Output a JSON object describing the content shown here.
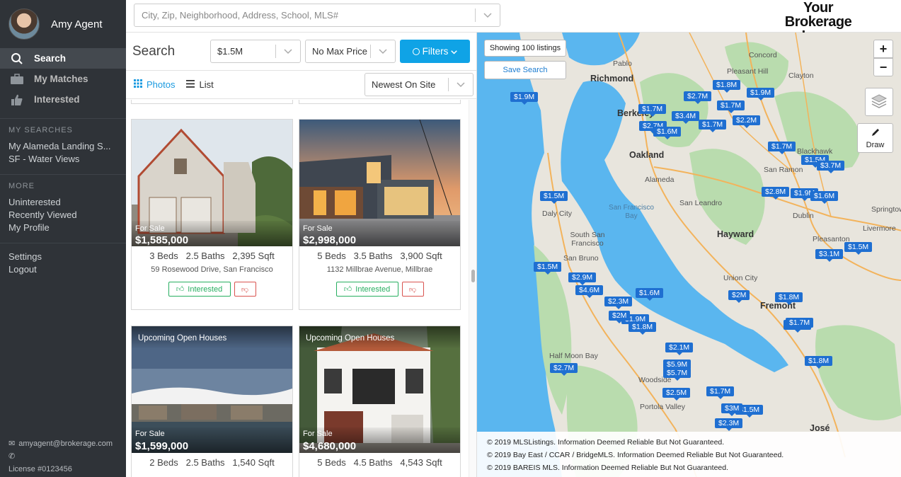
{
  "user": {
    "name": "Amy Agent",
    "email": "amyagent@brokerage.com",
    "license": "License #0123456"
  },
  "nav": [
    {
      "label": "Search",
      "icon": "search-icon",
      "active": true
    },
    {
      "label": "My Matches",
      "icon": "briefcase-icon",
      "active": false
    },
    {
      "label": "Interested",
      "icon": "thumbs-up-icon",
      "active": false
    }
  ],
  "my_searches": {
    "heading": "MY SEARCHES",
    "items": [
      "My Alameda Landing S...",
      "SF - Water Views"
    ]
  },
  "more": {
    "heading": "MORE",
    "items": [
      "Uninterested",
      "Recently Viewed",
      "My Profile"
    ]
  },
  "account_links": [
    "Settings",
    "Logout"
  ],
  "top_search": {
    "placeholder": "City, Zip, Neighborhood, Address, School, MLS#"
  },
  "brand": {
    "line1": "Your Brokerage",
    "line2": "Logo"
  },
  "search_panel": {
    "title": "Search",
    "min_price": "$1.5M",
    "max_price": "No Max Price",
    "filters_label": "Filters",
    "views": {
      "photos": "Photos",
      "list": "List"
    },
    "sort": "Newest On Site"
  },
  "listings": [
    {
      "status": "For Sale",
      "price": "$1,585,000",
      "beds": "3 Beds",
      "baths": "2.5 Baths",
      "sqft": "2,395 Sqft",
      "address": "59 Rosewood Drive, San Francisco",
      "interested_label": "Interested",
      "top_label": ""
    },
    {
      "status": "For Sale",
      "price": "$2,998,000",
      "beds": "5 Beds",
      "baths": "3.5 Baths",
      "sqft": "3,900 Sqft",
      "address": "1132 Millbrae Avenue, Millbrae",
      "interested_label": "Interested",
      "top_label": ""
    },
    {
      "status": "For Sale",
      "price": "$1,599,000",
      "beds": "2 Beds",
      "baths": "2.5 Baths",
      "sqft": "1,540 Sqft",
      "address": "",
      "interested_label": "",
      "top_label": "Upcoming Open Houses"
    },
    {
      "status": "For Sale",
      "price": "$4,680,000",
      "beds": "5 Beds",
      "baths": "4.5 Baths",
      "sqft": "4,543 Sqft",
      "address": "",
      "interested_label": "",
      "top_label": "Upcoming Open Houses"
    }
  ],
  "map": {
    "listing_count": "Showing 100 listings",
    "save_search": "Save Search",
    "zoom_in": "+",
    "zoom_out": "−",
    "draw_label": "Draw",
    "places": [
      "Richmond",
      "Pablo",
      "Berkeley",
      "Oakland",
      "Alameda",
      "San Leandro",
      "Concord",
      "Pleasant Hill",
      "Clayton",
      "Blackhawk",
      "San Ramon",
      "Dublin",
      "Pleasanton",
      "Livermore",
      "Springtown",
      "Hayward",
      "Union City",
      "Fremont",
      "Daly City",
      "South San Francisco",
      "San Bruno",
      "San Francisco Bay",
      "Half Moon Bay",
      "Woodside",
      "Portola Valley",
      "José"
    ],
    "pins": [
      "$1.9M",
      "$2.7M",
      "$1.8M",
      "$1.9M",
      "$1.7M",
      "$1.7M",
      "$3.4M",
      "$2.7M",
      "$1.6M",
      "$1.7M",
      "$2.2M",
      "$1.7M",
      "$1.5M",
      "$3.7M",
      "$2.8M",
      "$1.9M",
      "$1.6M",
      "$1.5M",
      "$1.5M",
      "$2M",
      "$3.1M",
      "$1.5M",
      "$2.9M",
      "$4.6M",
      "$1.6M",
      "$2.3M",
      "$1.9M",
      "$1.8M",
      "$2M",
      "$1.8M",
      "$1.7M",
      "$2.1M",
      "$5.9M",
      "$5.7M",
      "$2.5M",
      "$1.7M",
      "$2.7M",
      "$1.8M",
      "$2.3M",
      "$1.5M",
      "$3M",
      "$1.7M"
    ],
    "copyright": [
      "© 2019 MLSListings. Information Deemed Reliable But Not Guaranteed.",
      "© 2019 Bay East / CCAR / BridgeMLS. Information Deemed Reliable But Not Guaranteed.",
      "© 2019 BAREIS MLS. Information Deemed Reliable But Not Guaranteed."
    ]
  }
}
